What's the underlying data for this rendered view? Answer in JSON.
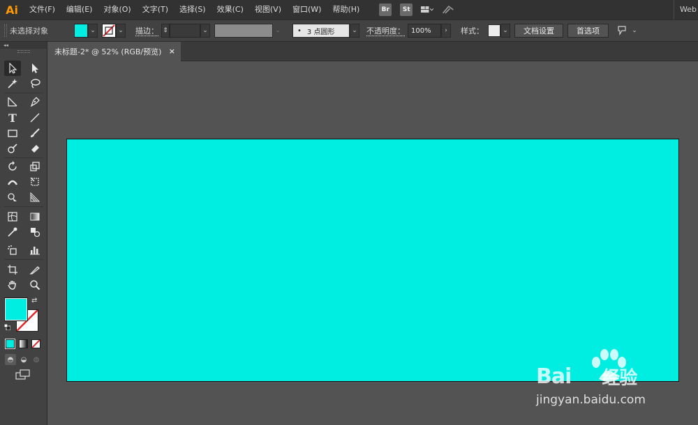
{
  "app": {
    "logo": "Ai",
    "workspace": "Web"
  },
  "menu": [
    "文件(F)",
    "编辑(E)",
    "对象(O)",
    "文字(T)",
    "选择(S)",
    "效果(C)",
    "视图(V)",
    "窗口(W)",
    "帮助(H)"
  ],
  "menubar_icons": {
    "bridge": "Br",
    "stock": "St"
  },
  "control": {
    "selection_status": "未选择对象",
    "stroke_label": "描边：",
    "brush_value": "3 点圆形",
    "opacity_label": "不透明度：",
    "opacity_value": "100%",
    "style_label": "样式：",
    "doc_setup_button": "文档设置",
    "preferences_button": "首选项"
  },
  "document": {
    "tab_title": "未标题-2* @ 52% (RGB/预览)",
    "close_glyph": "×"
  },
  "colors": {
    "fill": "#00ede1",
    "stroke_none": "#e3262c",
    "artboard": "#00ede1",
    "accent": "#ff9a00"
  },
  "toolbar_icons": [
    "selection-tool",
    "direct-selection-tool",
    "magic-wand-tool",
    "lasso-tool",
    "pen-tool",
    "curvature-tool",
    "type-tool",
    "line-segment-tool",
    "rectangle-tool",
    "paintbrush-tool",
    "shaper-tool",
    "eraser-tool",
    "rotate-tool",
    "scale-tool",
    "width-tool",
    "free-transform-tool",
    "shape-builder-tool",
    "perspective-grid-tool",
    "mesh-tool",
    "gradient-tool",
    "eyedropper-tool",
    "blend-tool",
    "symbol-sprayer-tool",
    "column-graph-tool",
    "artboard-tool",
    "slice-tool",
    "hand-tool",
    "zoom-tool"
  ],
  "watermark": {
    "brand": "Bai",
    "brand_suffix": "经验",
    "url": "jingyan.baidu.com"
  }
}
